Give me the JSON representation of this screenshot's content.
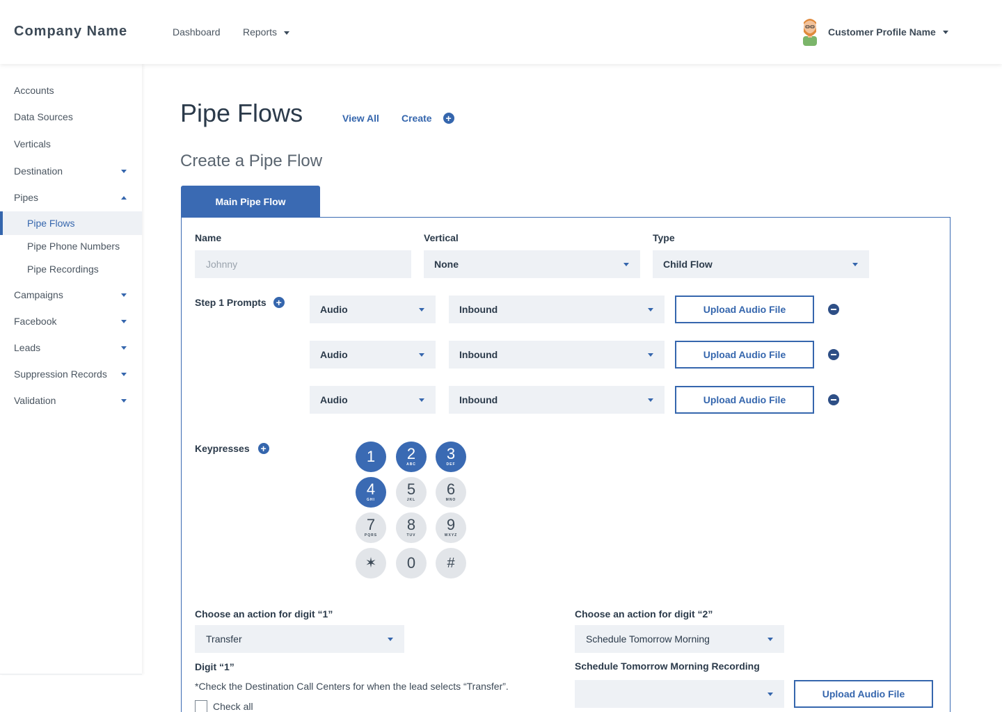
{
  "header": {
    "brand": "Company Name",
    "nav": [
      {
        "label": "Dashboard"
      },
      {
        "label": "Reports"
      }
    ],
    "profile_name": "Customer Profile Name"
  },
  "sidebar": {
    "items": [
      {
        "label": "Accounts"
      },
      {
        "label": "Data Sources"
      },
      {
        "label": "Verticals"
      },
      {
        "label": "Destination"
      },
      {
        "label": "Pipes"
      },
      {
        "label": "Pipe Flows"
      },
      {
        "label": "Pipe Phone Numbers"
      },
      {
        "label": "Pipe Recordings"
      },
      {
        "label": "Campaigns"
      },
      {
        "label": "Facebook"
      },
      {
        "label": "Leads"
      },
      {
        "label": "Suppression Records"
      },
      {
        "label": "Validation"
      }
    ]
  },
  "main": {
    "title": "Pipe Flows",
    "view_all": "View All",
    "create": "Create",
    "subtitle": "Create a Pipe Flow",
    "tab": "Main Pipe Flow"
  },
  "form": {
    "name_label": "Name",
    "name_placeholder": "Johnny",
    "vertical_label": "Vertical",
    "vertical_value": "None",
    "type_label": "Type",
    "type_value": "Child Flow",
    "prompts_label": "Step 1 Prompts",
    "prompts": [
      {
        "kind": "Audio",
        "direction": "Inbound",
        "upload": "Upload Audio File"
      },
      {
        "kind": "Audio",
        "direction": "Inbound",
        "upload": "Upload Audio File"
      },
      {
        "kind": "Audio",
        "direction": "Inbound",
        "upload": "Upload Audio File"
      }
    ],
    "keypresses_label": "Keypresses",
    "keypad": [
      {
        "num": "1",
        "letters": ""
      },
      {
        "num": "2",
        "letters": "ABC"
      },
      {
        "num": "3",
        "letters": "DEF"
      },
      {
        "num": "4",
        "letters": "GHI"
      },
      {
        "num": "5",
        "letters": "JKL"
      },
      {
        "num": "6",
        "letters": "MNO"
      },
      {
        "num": "7",
        "letters": "PQRS"
      },
      {
        "num": "8",
        "letters": "TUV"
      },
      {
        "num": "9",
        "letters": "WXYZ"
      },
      {
        "num": "✶",
        "letters": ""
      },
      {
        "num": "0",
        "letters": ""
      },
      {
        "num": "#",
        "letters": ""
      }
    ],
    "digit1_action_label": "Choose an action for digit “1”",
    "digit1_action_value": "Transfer",
    "digit1_heading": "Digit “1”",
    "digit1_note": "*Check the Destination Call Centers for when the lead selects “Transfer”.",
    "check_all": "Check all",
    "digit2_action_label": "Choose an action for digit “2”",
    "digit2_action_value": "Schedule Tomorrow Morning",
    "digit2_recording_label": "Schedule Tomorrow Morning Recording",
    "digit2_recording_value": "",
    "digit2_upload": "Upload Audio File"
  },
  "colors": {
    "accent": "#3566ad",
    "tab": "#3a6ab3",
    "field_bg": "#eef1f5",
    "key_inactive": "#e2e5e9"
  }
}
